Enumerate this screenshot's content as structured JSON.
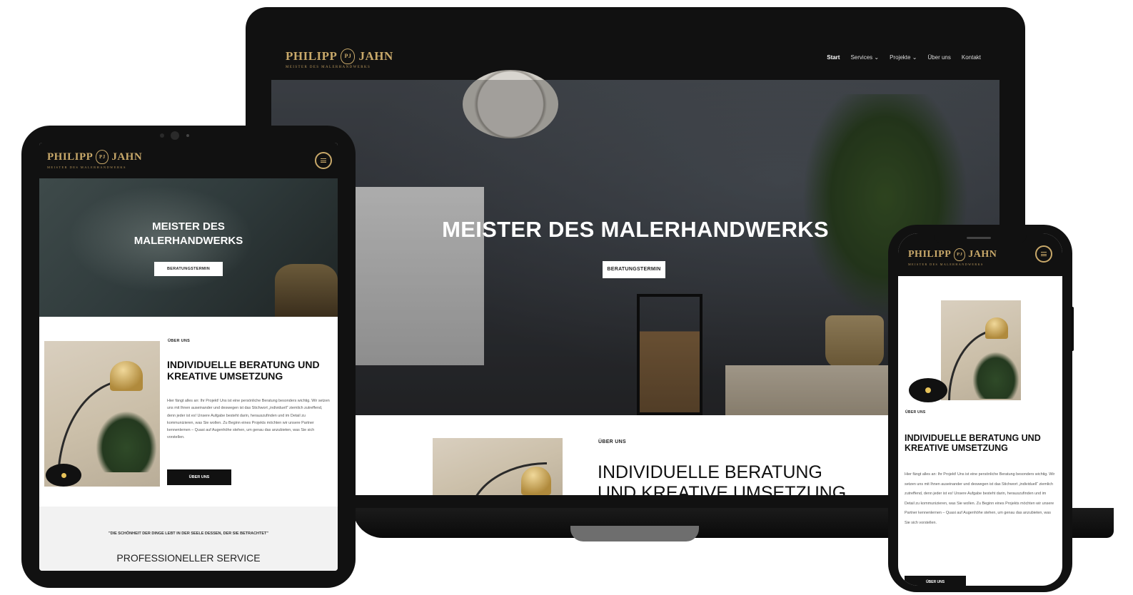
{
  "brand": {
    "name_left": "PHILIPP",
    "crest": "PJ",
    "name_right": "JAHN",
    "tagline": "MEISTER DES MALERHANDWERKS"
  },
  "nav": {
    "items": [
      "Start",
      "Services",
      "Projekte",
      "Über uns",
      "Kontakt"
    ]
  },
  "hero": {
    "title": "MEISTER DES MALERHANDWERKS",
    "tablet_title_line1": "MEISTER DES",
    "tablet_title_line2": "MALERHANDWERKS",
    "button": "BERATUNGSTERMIN"
  },
  "about": {
    "eyebrow": "ÜBER UNS",
    "heading": "INDIVIDUELLE BERATUNG UND KREATIVE UMSETZUNG",
    "heading_line1": "INDIVIDUELLE BERATUNG",
    "heading_line2": "UND KREATIVE UMSETZUNG",
    "body": "Hier fängt alles an: Ihr Projekt! Uns ist eine persönliche Beratung besonders wichtig. Wir setzen uns mit Ihnen auseinander und deswegen ist das Stichwort „individuell“ ziemlich zutreffend, denn jeder ist es! Unsere Aufgabe besteht darin, herauszufinden und im Detail zu kommunizieren, was Sie wollen. Zu Beginn eines Projekts möchten wir unsere Partner kennenlernen – Quasi auf Augenhöhe stehen, um genau das anzubieten, was Sie sich vorstellen.",
    "button": "ÜBER UNS"
  },
  "quote": {
    "text": "\"DIE SCHÖNHEIT DER DINGE LEBT IN DER SEELE DESSEN, DER SIE BETRACHTET\"",
    "service_heading": "PROFESSIONELLER SERVICE"
  },
  "colors": {
    "gold": "#c9a96a",
    "header_bg": "#111111",
    "device_frame": "#111111"
  }
}
